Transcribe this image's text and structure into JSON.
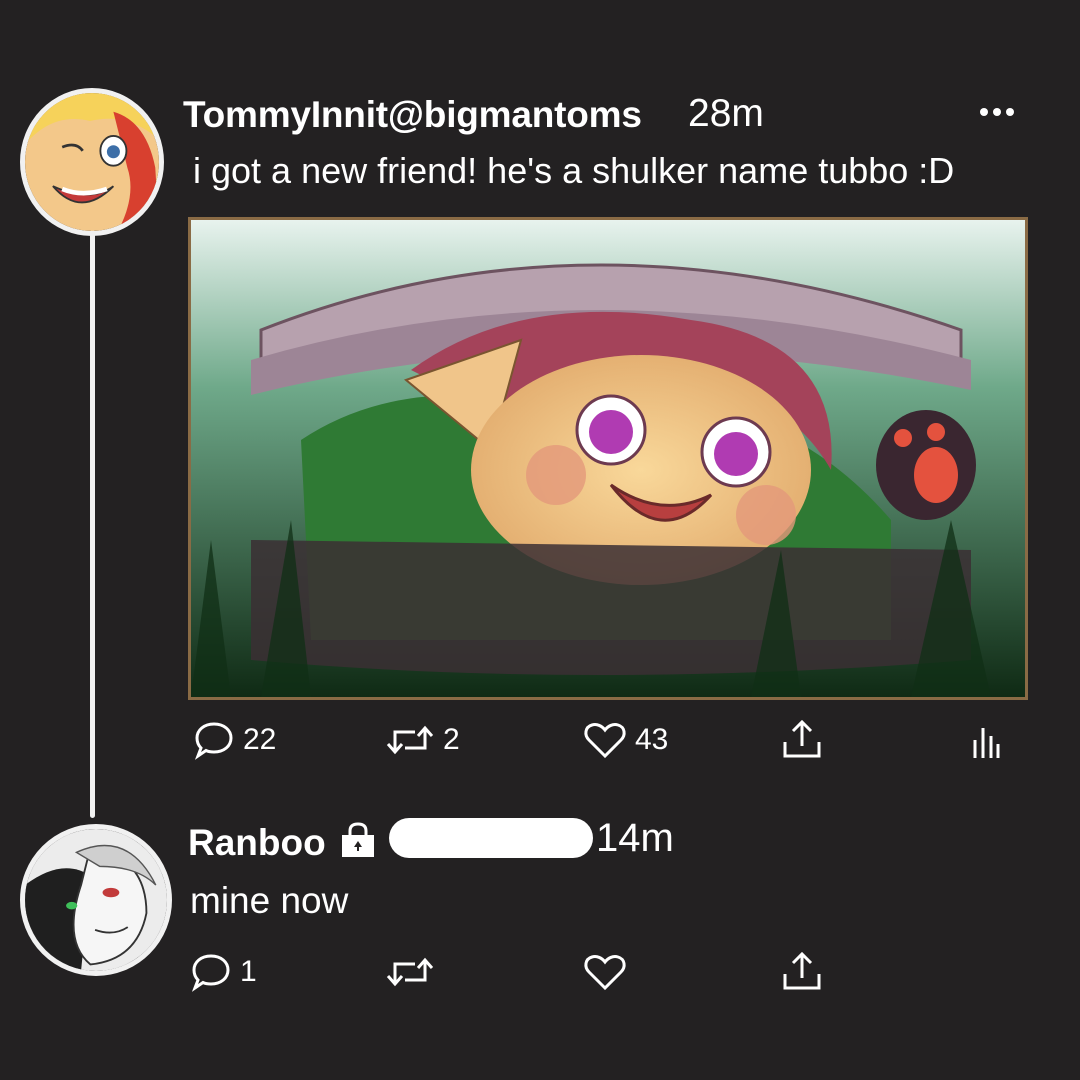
{
  "post1": {
    "author": "TommyInnit@bigmantoms",
    "time": "28m",
    "text": "i got a new friend! he's a shulker name tubbo :D",
    "more_icon": "ellipsis-icon",
    "image_alt": "drawing of a shulker boy peeking out of a shell in the grass",
    "actions": {
      "reply_count": "22",
      "retweet_count": "2",
      "like_count": "43"
    }
  },
  "post2": {
    "author": "Ranboo",
    "badge_icon": "lock-icon",
    "time": "14m",
    "text": "mine now",
    "actions": {
      "reply_count": "1"
    }
  },
  "colors": {
    "background": "#232122",
    "text": "#ffffff",
    "thread_line": "#f2f2f2"
  }
}
